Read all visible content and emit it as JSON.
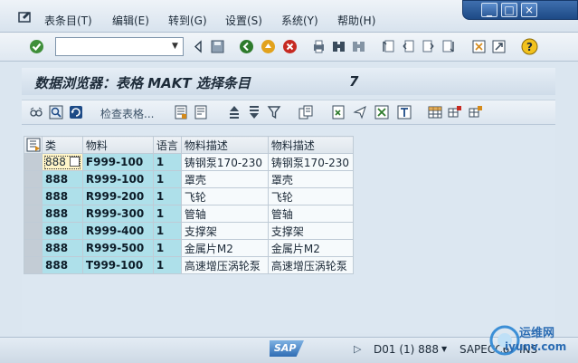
{
  "menu": {
    "items": [
      "表条目(T)",
      "编辑(E)",
      "转到(G)",
      "设置(S)",
      "系统(Y)",
      "帮助(H)"
    ]
  },
  "window_controls": [
    "_",
    "□",
    "×"
  ],
  "toolbar": {
    "okcode_value": "",
    "icons": [
      "enter-icon",
      "back-icon",
      "save-icon",
      "back-nav-icon",
      "exit-icon",
      "cancel-icon",
      "print-icon",
      "find-icon",
      "find-next-icon",
      "first-page-icon",
      "prev-page-icon",
      "next-page-icon",
      "last-page-icon",
      "create-session-icon",
      "shortcut-icon",
      "help-icon"
    ]
  },
  "title": {
    "text": "数据浏览器：表格 MAKT 选择条目",
    "count": "7"
  },
  "app_toolbar": {
    "check_tables_label": "检查表格..."
  },
  "table": {
    "headers": [
      "类",
      "物料",
      "语言",
      "物料描述",
      "物料描述"
    ],
    "rows": [
      [
        "888",
        "F999-100",
        "1",
        "铸钢泵170-230",
        "铸钢泵170-230"
      ],
      [
        "888",
        "R999-100",
        "1",
        "罩壳",
        "罩壳"
      ],
      [
        "888",
        "R999-200",
        "1",
        "飞轮",
        "飞轮"
      ],
      [
        "888",
        "R999-300",
        "1",
        "管轴",
        "管轴"
      ],
      [
        "888",
        "R999-400",
        "1",
        "支撑架",
        "支撑架"
      ],
      [
        "888",
        "R999-500",
        "1",
        "金属片M2",
        "金属片M2"
      ],
      [
        "888",
        "T999-100",
        "1",
        "高速增压涡轮泵",
        "高速增压涡轮泵"
      ]
    ]
  },
  "status": {
    "system": "D01 (1) 888",
    "server": "SAPECC6",
    "mode": "INS"
  },
  "watermark": {
    "line1": "运维网",
    "line2": "iyunv.com"
  },
  "colors": {
    "key_column": "#aee0ea",
    "focus_cell": "#fff5c8",
    "window_controls": "#2c5a98"
  }
}
